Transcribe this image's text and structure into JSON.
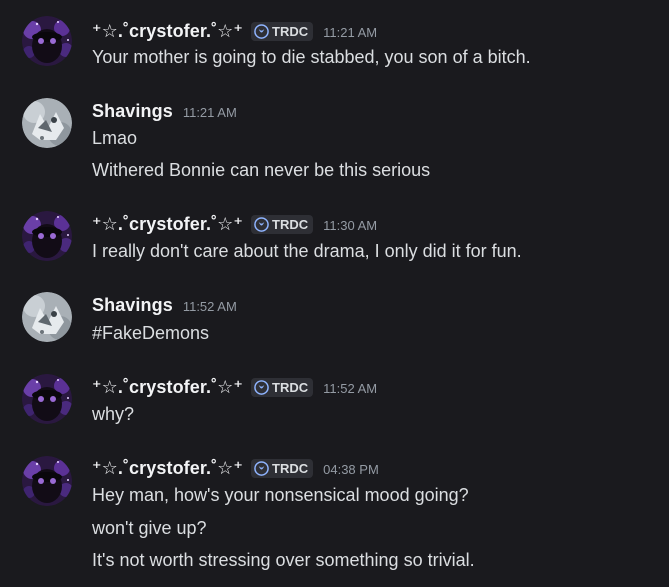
{
  "messages": [
    {
      "author": "⁺☆.˚crystofer.˚☆⁺",
      "tag": "TRDC",
      "time": "11:21 AM",
      "lines": [
        "Your mother is going to die stabbed, you son of a bitch."
      ]
    },
    {
      "author": "Shavings",
      "time": "11:21 AM",
      "lines": [
        "Lmao",
        "Withered Bonnie can never be this serious"
      ]
    },
    {
      "author": "⁺☆.˚crystofer.˚☆⁺",
      "tag": "TRDC",
      "time": "11:30 AM",
      "lines": [
        "I really don't care about the drama, I only did it for fun."
      ]
    },
    {
      "author": "Shavings",
      "time": "11:52 AM",
      "lines": [
        "#FakeDemons"
      ]
    },
    {
      "author": "⁺☆.˚crystofer.˚☆⁺",
      "tag": "TRDC",
      "time": "11:52 AM",
      "lines": [
        "why?"
      ]
    },
    {
      "author": "⁺☆.˚crystofer.˚☆⁺",
      "tag": "TRDC",
      "time": "04:38 PM",
      "lines": [
        "Hey man, how's your nonsensical mood going?",
        "won't give up?",
        "It's not worth stressing over something so trivial."
      ]
    }
  ],
  "icons": {
    "crystofer_avatar": "avatar-crystofer",
    "shavings_avatar": "avatar-shavings",
    "tag_icon": "moon-badge-icon"
  },
  "colors": {
    "background": "#1a1a1e",
    "username": "#f2f3f5",
    "message_text": "#dbdee1",
    "timestamp": "#949ba4",
    "tag_background": "#2e2f35",
    "tag_icon": "#8fb4ff"
  }
}
